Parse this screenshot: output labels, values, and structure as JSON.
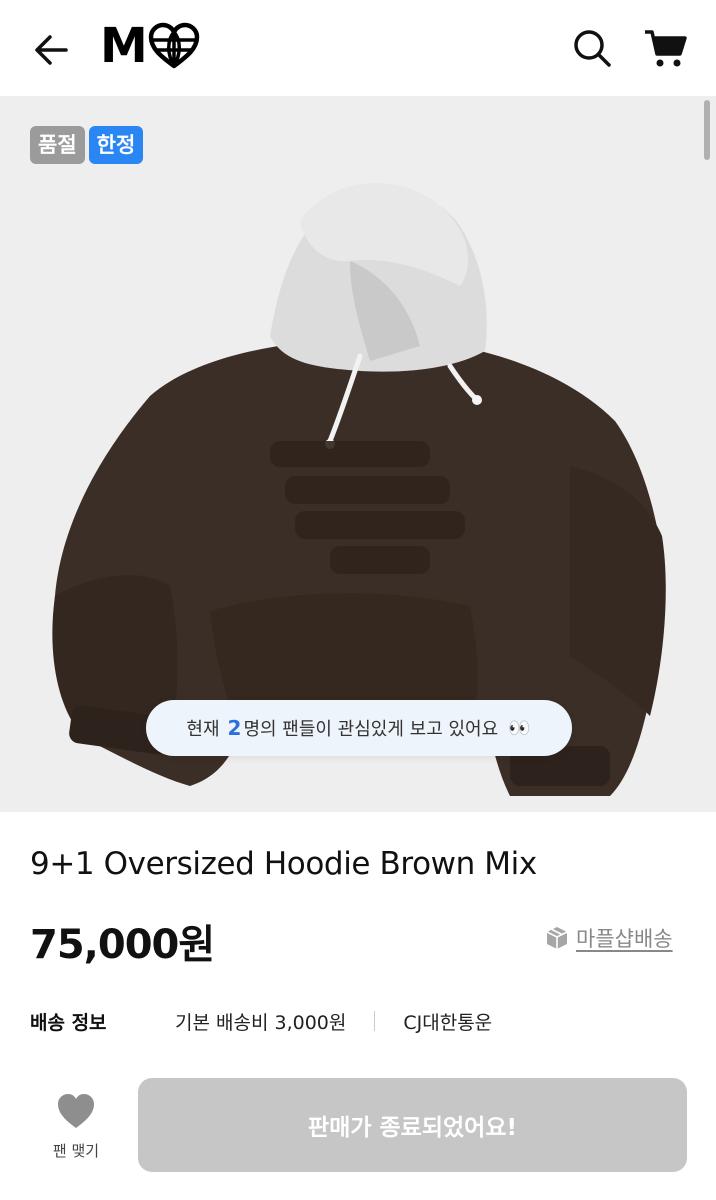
{
  "header": {
    "logo_letter": "M",
    "back_icon": "arrow-left-icon",
    "search_icon": "search-icon",
    "cart_icon": "cart-icon"
  },
  "hero": {
    "badges": [
      "품절",
      "한정"
    ],
    "badge_colors": [
      "#9b9b9b",
      "#2a86f3"
    ],
    "viewers": {
      "prefix": "현재",
      "count": "2",
      "suffix": "명의 팬들이 관심있게 보고 있어요",
      "emoji": "👀"
    }
  },
  "product": {
    "title": "9+1 Oversized Hoodie Brown Mix",
    "price": "75,000원",
    "shipping_tag": "마플샵배송"
  },
  "shipping": {
    "label": "배송 정보",
    "fee": "기본 배송비 3,000원",
    "courier": "CJ대한통운"
  },
  "bottom": {
    "fan_label": "팬 맺기",
    "cta_label": "판매가 종료되었어요!"
  },
  "colors": {
    "accent": "#2a86f3",
    "soldout": "#9b9b9b",
    "cta_disabled": "#c6c6c6"
  }
}
